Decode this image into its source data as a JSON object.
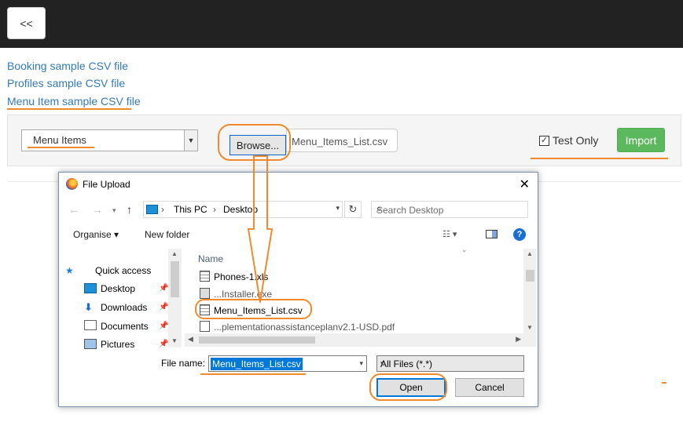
{
  "header": {
    "back_label": "<<"
  },
  "links": {
    "booking": "Booking sample CSV file",
    "profiles": "Profiles sample CSV file",
    "menu_item": "Menu Item sample CSV file"
  },
  "import_form": {
    "type_select_value": "Menu Items",
    "browse_label": "Browse...",
    "file_name": "Menu_Items_List.csv",
    "test_only_label": "Test Only",
    "test_only_checked": true,
    "import_label": "Import"
  },
  "dialog": {
    "title": "File Upload",
    "close_glyph": "✕",
    "breadcrumb": [
      "This PC",
      "Desktop"
    ],
    "search_placeholder": "Search Desktop",
    "toolbar": {
      "organise": "Organise ▾",
      "new_folder": "New folder"
    },
    "nav_items": [
      {
        "label": "Quick access",
        "icon": "star-icon"
      },
      {
        "label": "Desktop",
        "icon": "desktop-icon"
      },
      {
        "label": "Downloads",
        "icon": "download-icon"
      },
      {
        "label": "Documents",
        "icon": "documents-icon"
      },
      {
        "label": "Pictures",
        "icon": "pictures-icon"
      }
    ],
    "column_name": "Name",
    "files": [
      "Phones-1.xls",
      "...Installer.exe",
      "Menu_Items_List.csv",
      "...plementationassistanceplanv2.1-USD.pdf"
    ],
    "file_name_label": "File name:",
    "file_name_value": "Menu_Items_List.csv",
    "file_type_value": "All Files (*.*)",
    "open_label": "Open",
    "cancel_label": "Cancel"
  },
  "colors": {
    "annotation": "#f08a2c",
    "import_green": "#5cb85c",
    "link_blue": "#337ab7",
    "topbar": "#222222"
  }
}
